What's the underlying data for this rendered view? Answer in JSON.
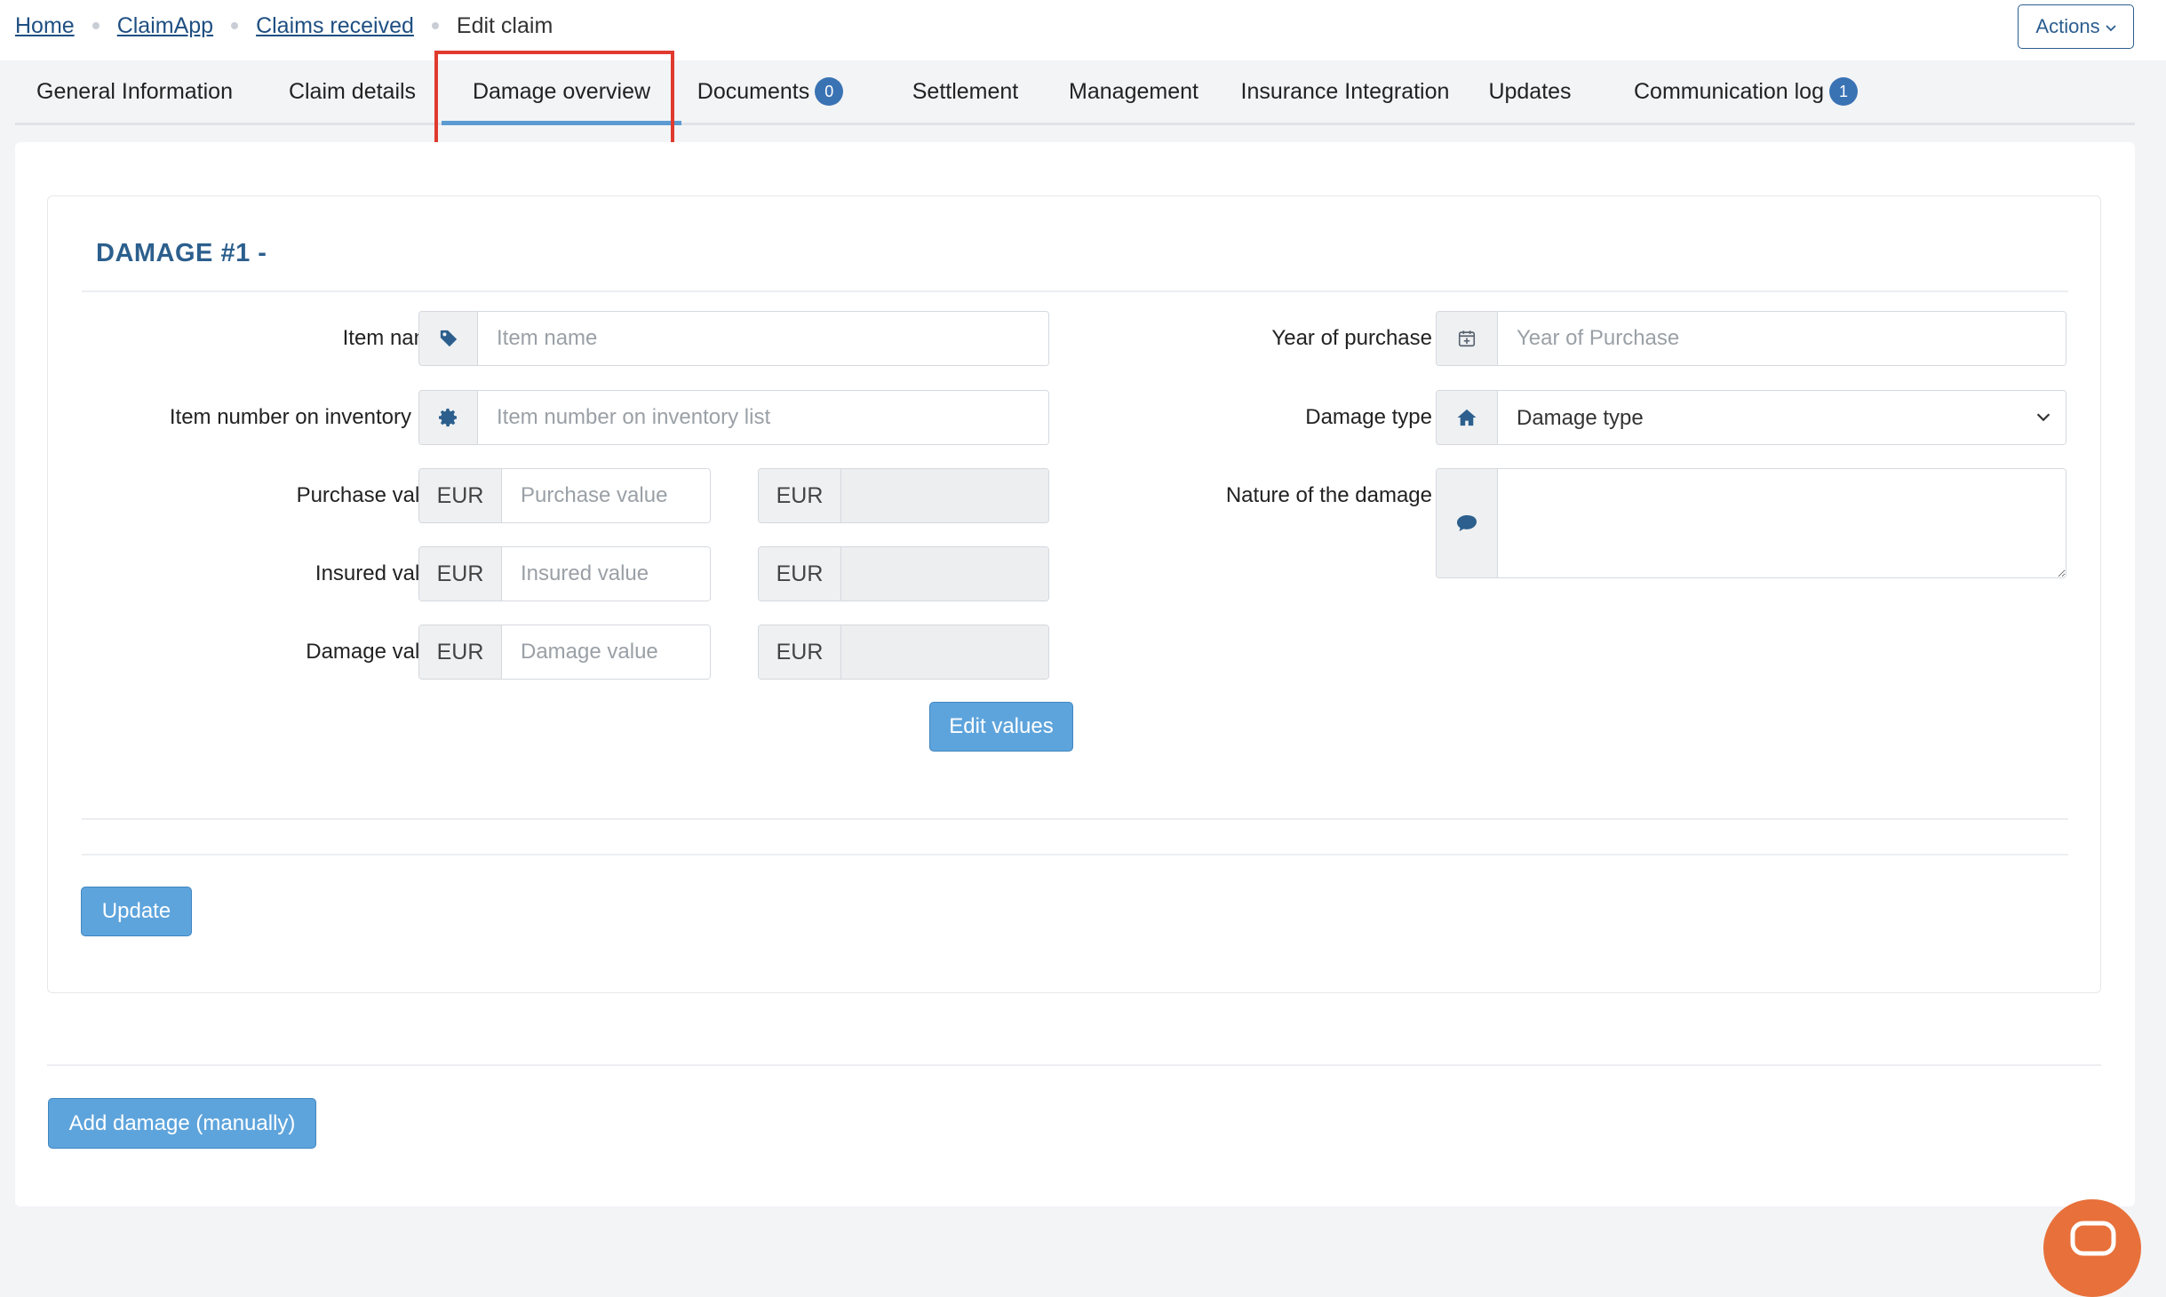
{
  "breadcrumb": {
    "home": "Home",
    "app": "ClaimApp",
    "claims_received": "Claims received",
    "current": "Edit claim"
  },
  "header": {
    "actions_label": "Actions"
  },
  "tabs": [
    {
      "label": "General Information"
    },
    {
      "label": "Claim details"
    },
    {
      "label": "Damage overview",
      "active": true
    },
    {
      "label": "Documents",
      "badge": "0"
    },
    {
      "label": "Settlement"
    },
    {
      "label": "Management"
    },
    {
      "label": "Insurance Integration"
    },
    {
      "label": "Updates"
    },
    {
      "label": "Communication log",
      "badge": "1"
    }
  ],
  "damage": {
    "title": "DAMAGE #1 -",
    "item_name": {
      "label": "Item name",
      "placeholder": "Item name",
      "icon": "tag-icon"
    },
    "item_number": {
      "label": "Item number on inventory list",
      "placeholder": "Item number on inventory list",
      "icon": "gear-icon"
    },
    "purchase_value": {
      "label": "Purchase value",
      "currency": "EUR",
      "placeholder": "Purchase value",
      "currency_2": "EUR"
    },
    "insured_value": {
      "label": "Insured value",
      "currency": "EUR",
      "placeholder": "Insured value",
      "currency_2": "EUR"
    },
    "damage_value": {
      "label": "Damage value",
      "currency": "EUR",
      "placeholder": "Damage value",
      "currency_2": "EUR"
    },
    "edit_values_label": "Edit values",
    "year_of_purchase": {
      "label": "Year of purchase",
      "placeholder": "Year of Purchase",
      "icon": "calendar-plus-icon"
    },
    "damage_type": {
      "label": "Damage type",
      "selected": "Damage type",
      "icon": "home-icon"
    },
    "nature": {
      "label": "Nature of the damage",
      "icon": "comment-icon"
    },
    "update_label": "Update"
  },
  "add_damage_label": "Add damage (manually)",
  "colors": {
    "accent": "#5ea4dc",
    "title": "#2c5f8d",
    "badge": "#3a73b4",
    "highlight": "#e03a2f",
    "chat": "#e8703a"
  }
}
